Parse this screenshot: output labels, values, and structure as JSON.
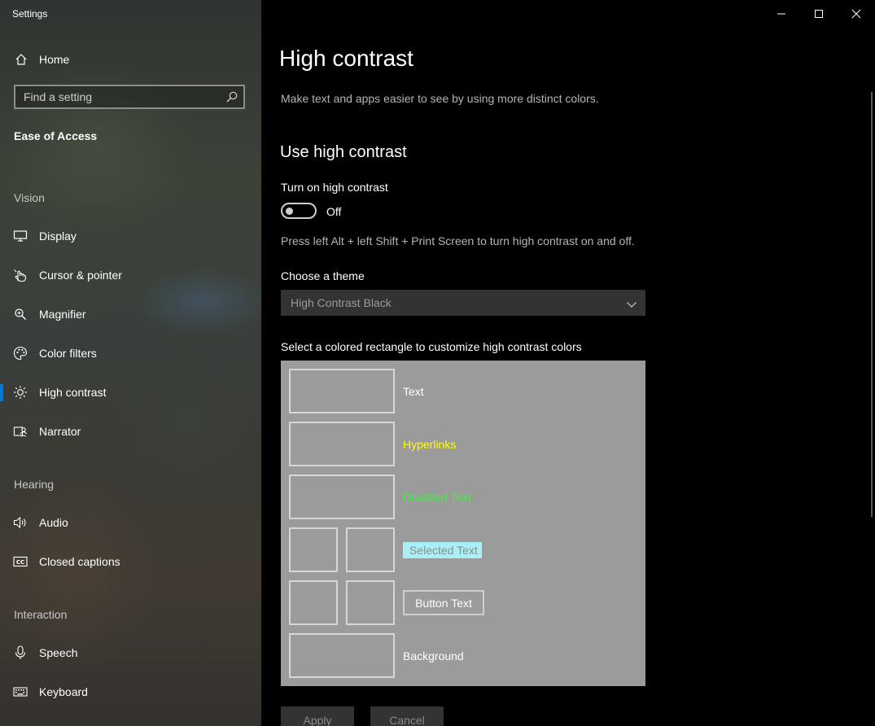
{
  "window": {
    "title": "Settings"
  },
  "sidebar": {
    "home_label": "Home",
    "search_placeholder": "Find a setting",
    "section_title": "Ease of Access",
    "groups": {
      "vision": "Vision",
      "hearing": "Hearing",
      "interaction": "Interaction"
    },
    "items": {
      "display": "Display",
      "cursor": "Cursor & pointer",
      "magnifier": "Magnifier",
      "color_filters": "Color filters",
      "high_contrast": "High contrast",
      "narrator": "Narrator",
      "audio": "Audio",
      "closed_captions": "Closed captions",
      "speech": "Speech",
      "keyboard": "Keyboard"
    },
    "selected_item": "High contrast",
    "accent_color": "#0078d7"
  },
  "main": {
    "title": "High contrast",
    "description": "Make text and apps easier to see by using more distinct colors.",
    "section_title": "Use high contrast",
    "toggle": {
      "label": "Turn on high contrast",
      "state": "Off",
      "on": false
    },
    "hint": "Press left Alt + left Shift + Print Screen to turn high contrast on and off.",
    "theme": {
      "label": "Choose a theme",
      "selected": "High Contrast Black"
    },
    "colors": {
      "label": "Select a colored rectangle to customize high contrast colors",
      "text": "Text",
      "hyperlinks": "Hyperlinks",
      "disabled_text": "Disabled Text",
      "selected_text": "Selected Text",
      "button_text": "Button Text",
      "background": "Background",
      "hyperlink_color": "#ffff00",
      "disabled_color": "#3ff23f",
      "selected_bg_color": "#a8f0f5",
      "palette_bg_color": "#9b9b9b"
    },
    "actions": {
      "apply": "Apply",
      "cancel": "Cancel"
    }
  }
}
